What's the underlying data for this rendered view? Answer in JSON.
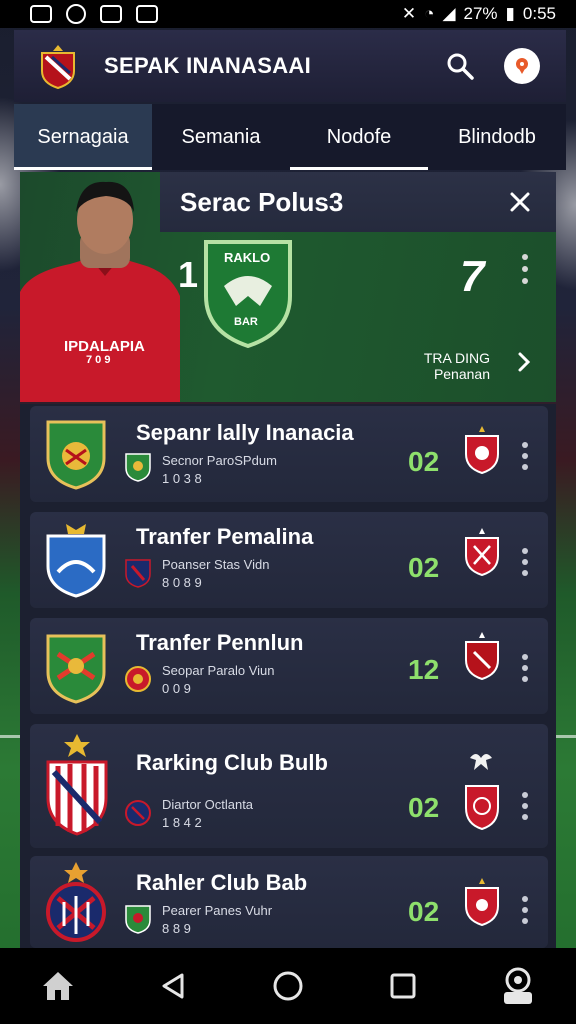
{
  "status_bar": {
    "battery": "27%",
    "time": "0:55"
  },
  "app_bar": {
    "title": "SEPAK INANASAAI",
    "logo_icon": "club-crest-icon",
    "search_icon": "search-icon",
    "notification_icon": "alert-icon"
  },
  "tabs": [
    {
      "label": "Sernagaia"
    },
    {
      "label": "Semania"
    },
    {
      "label": "Nodofe"
    },
    {
      "label": "Blindodb"
    }
  ],
  "hero": {
    "title": "Serac Polus3",
    "jersey_text": "IPDALAPIA",
    "jersey_sub": "7 0 9",
    "left_number": "1",
    "crest_top": "RAKLO",
    "crest_bottom": "BAR",
    "score": "7",
    "trend_line1": "TRA DING",
    "trend_line2": "Penanan"
  },
  "items": [
    {
      "name": "Sepanr lally Inanacia",
      "sub1": "Secnor ParoSPdum",
      "sub2": "1 0 3 8",
      "score": "02"
    },
    {
      "name": "Tranfer Pemalina",
      "sub1": "Poanser Stas Vidn",
      "sub2": "8 0 8 9",
      "score": "02"
    },
    {
      "name": "Tranfer Pennlun",
      "sub1": "Seopar Paralo Viun",
      "sub2": "0 0 9",
      "score": "12"
    },
    {
      "name": "Rarking Club Bulb",
      "sub1": "Diartor Octlanta",
      "sub2": "1 8 4 2",
      "score": "02"
    },
    {
      "name": "Rahler Club Bab",
      "sub1": "Pearer Panes Vuhr",
      "sub2": "8 8 9",
      "score": "02"
    }
  ],
  "colors": {
    "accent_green": "#8ee06c",
    "app_bar": "#24253f",
    "card": "#262b40",
    "hero_green": "#1f5a2f",
    "jersey_red": "#c8192a"
  },
  "nav": {
    "home_icon": "home-icon",
    "back_icon": "back-icon",
    "home_circle_icon": "home-circle-icon",
    "recents_icon": "recents-icon",
    "assistant_icon": "assistant-icon"
  }
}
